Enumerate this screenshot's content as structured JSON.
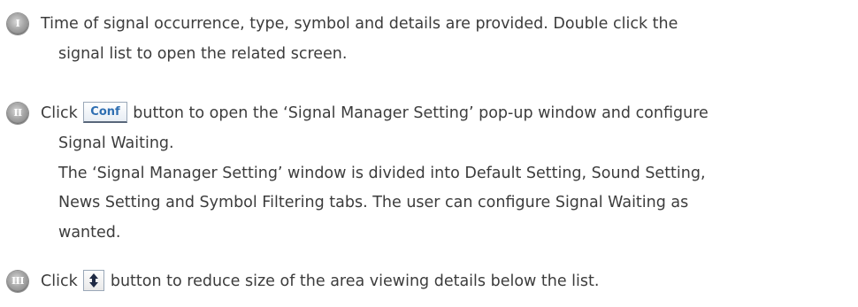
{
  "items": [
    {
      "marker": "I",
      "lines": [
        "Time of signal occurrence, type, symbol and details are provided. Double click the",
        "signal list to open the related screen."
      ]
    },
    {
      "marker": "II",
      "line1_before": "Click",
      "conf_button_label": "Conf",
      "line1_after": "button to open the ‘Signal Manager Setting’ pop-up window and configure",
      "lines": [
        "Signal Waiting.",
        "The ‘Signal Manager Setting’ window is divided into Default Setting, Sound Setting,",
        "News Setting and Symbol Filtering tabs. The user can configure Signal Waiting as",
        "wanted."
      ]
    },
    {
      "marker": "III",
      "line1_before": "Click",
      "line1_after": "button to reduce size of the area viewing details below the list.",
      "resize_button_icon": "up-down-arrow-icon"
    }
  ],
  "colors": {
    "text": "#3c3c3c",
    "marker": "#9e9e9e",
    "conf_button_text": "#2f6fb2"
  }
}
